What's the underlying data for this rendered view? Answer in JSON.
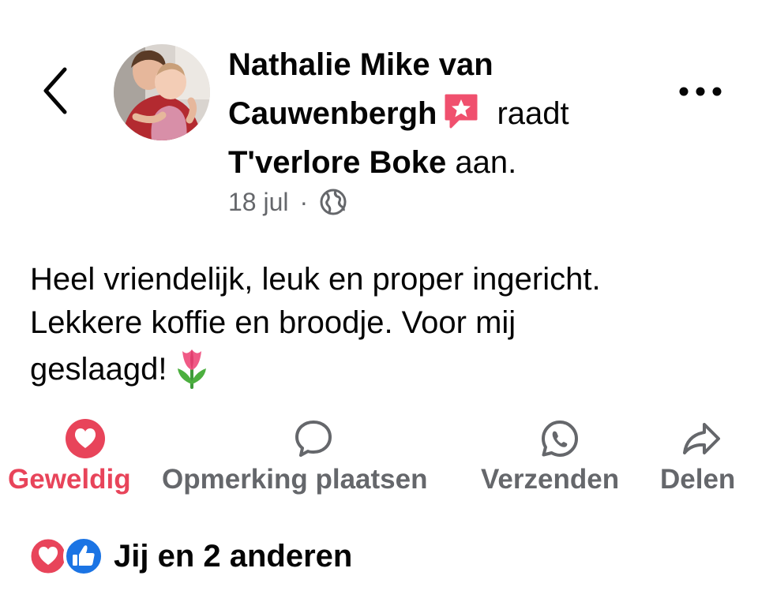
{
  "header": {
    "author_name": "Nathalie Mike van Cauwenbergh",
    "verb": "raadt",
    "place": "T'verlore Boke",
    "suffix": "aan.",
    "date": "18 jul",
    "separator": "·"
  },
  "post": {
    "text": "Heel vriendelijk, leuk en proper ingericht.\nLekkere koffie en broodje. Voor mij\ngeslaagd!",
    "emoji": "tulip-emoji"
  },
  "actions": [
    {
      "label": "Geweldig",
      "icon": "heart-icon",
      "active": true
    },
    {
      "label": "Opmerking plaatsen",
      "icon": "comment-icon",
      "active": false
    },
    {
      "label": "Verzenden",
      "icon": "whatsapp-icon",
      "active": false
    },
    {
      "label": "Delen",
      "icon": "share-icon",
      "active": false
    }
  ],
  "reactions": {
    "summary": "Jij en 2 anderen",
    "icons": [
      "love-reaction-icon",
      "like-reaction-icon"
    ]
  },
  "colors": {
    "love": "#e8445a",
    "like": "#1b74e4",
    "recommend_badge": "#f0506e",
    "secondary_text": "#65676b"
  }
}
